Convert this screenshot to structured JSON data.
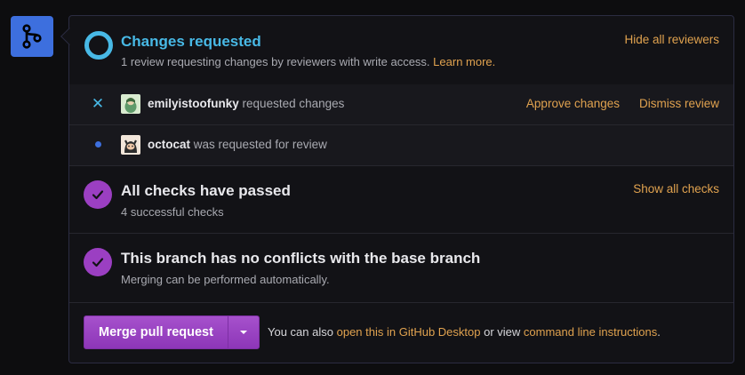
{
  "review_status": {
    "title": "Changes requested",
    "subtitle_prefix": "1 review requesting changes by reviewers with write access.",
    "learn_more": "Learn more.",
    "hide_reviewers": "Hide all reviewers"
  },
  "reviewers": [
    {
      "username": "emilyistoofunky",
      "status_text": "requested changes",
      "status_icon": "x-icon",
      "actions": {
        "approve": "Approve changes",
        "dismiss": "Dismiss review"
      }
    },
    {
      "username": "octocat",
      "status_text": "was requested for review",
      "status_icon": "dot-icon"
    }
  ],
  "checks": {
    "title": "All checks have passed",
    "subtitle": "4 successful checks",
    "show_all": "Show all checks"
  },
  "conflicts": {
    "title": "This branch has no conflicts with the base branch",
    "subtitle": "Merging can be performed automatically."
  },
  "merge": {
    "button_label": "Merge pull request",
    "note_prefix": "You can also",
    "desktop_link": "open this in GitHub Desktop",
    "note_middle": "or view",
    "cli_link": "command line instructions",
    "note_suffix": "."
  },
  "colors": {
    "background": "#0d0d0f",
    "panel": "#121216",
    "accent_blue": "#48b9e6",
    "branch_tile": "#3d6fde",
    "link_orange": "#e0a24f",
    "success_purple": "#9b3fc2"
  }
}
